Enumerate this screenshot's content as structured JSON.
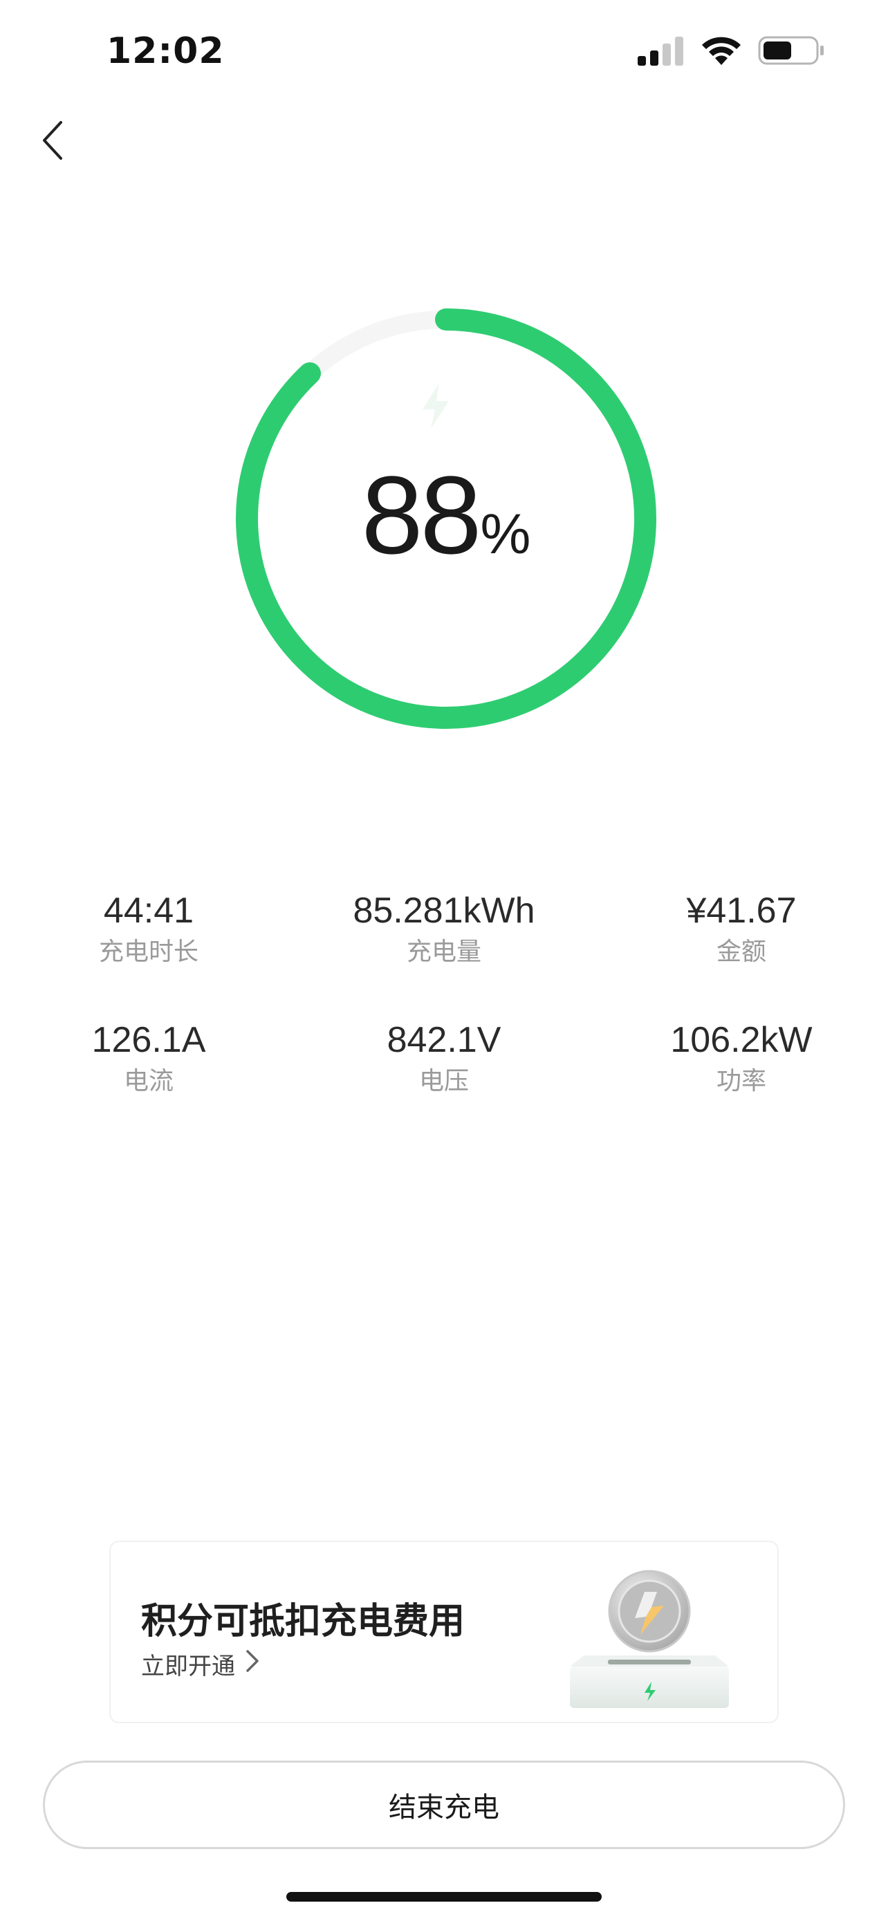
{
  "status_bar": {
    "time": "12:02"
  },
  "charging": {
    "percent_value": "88",
    "percent_unit": "%",
    "progress": 0.88,
    "accent_color": "#2ECC71",
    "track_color": "#F5F5F5"
  },
  "stats": [
    {
      "value": "44:41",
      "label": "充电时长"
    },
    {
      "value": "85.281kWh",
      "label": "充电量"
    },
    {
      "value": "¥41.67",
      "label": "金额"
    },
    {
      "value": "126.1A",
      "label": "电流"
    },
    {
      "value": "842.1V",
      "label": "电压"
    },
    {
      "value": "106.2kW",
      "label": "功率"
    }
  ],
  "promo": {
    "title": "积分可抵扣充电费用",
    "link_label": "立即开通"
  },
  "actions": {
    "end_charging_label": "结束充电"
  },
  "icons": {
    "back": "chevron-left-icon",
    "signal": "cellular-signal-icon",
    "wifi": "wifi-icon",
    "battery": "battery-icon",
    "bolt": "lightning-bolt-icon",
    "link_arrow": "chevron-right-icon",
    "promo_art": "points-coin-illustration"
  }
}
